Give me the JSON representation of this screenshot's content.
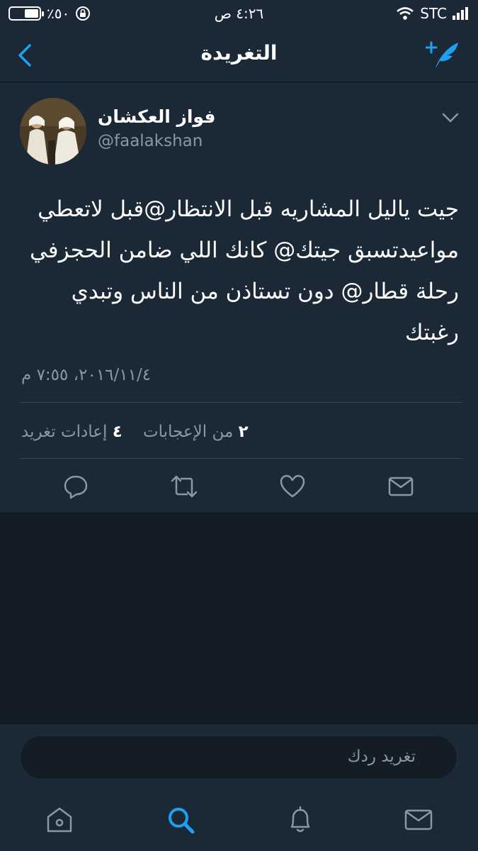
{
  "status_bar": {
    "battery": "٪٥٠",
    "time": "٤:٢٦ ص",
    "carrier": "STC",
    "battery_level": 0.5
  },
  "nav": {
    "title": "التغريدة"
  },
  "tweet": {
    "display_name": "فواز العكشان",
    "handle": "@faalakshan",
    "text": "جيت ياليل المشاريه قبل الانتظار@قبل لاتعطي مواعيدتسبق جيتك@ كانك اللي ضامن الحجزفي رحلة قطار@ دون تستاذن من الناس وتبدي رغبتك",
    "timestamp": "٢٠١٦/١١/٤، ٧:٥٥ م",
    "retweets_count": "٤",
    "retweets_label": "إعادات تغريد",
    "likes_count": "٢",
    "likes_label": "من الإعجابات"
  },
  "reply": {
    "placeholder": "تغريد ردك"
  },
  "colors": {
    "background": "#141d26",
    "card": "#1b2836",
    "accent": "#1da1f2",
    "muted": "#8899a6"
  },
  "icons": {
    "nav": [
      "back-chevron-icon",
      "compose-tweet-icon"
    ],
    "actions": [
      "reply-icon",
      "retweet-icon",
      "like-icon",
      "direct-message-icon"
    ],
    "tabs": [
      "home-icon",
      "search-icon",
      "notifications-icon",
      "messages-icon"
    ]
  }
}
